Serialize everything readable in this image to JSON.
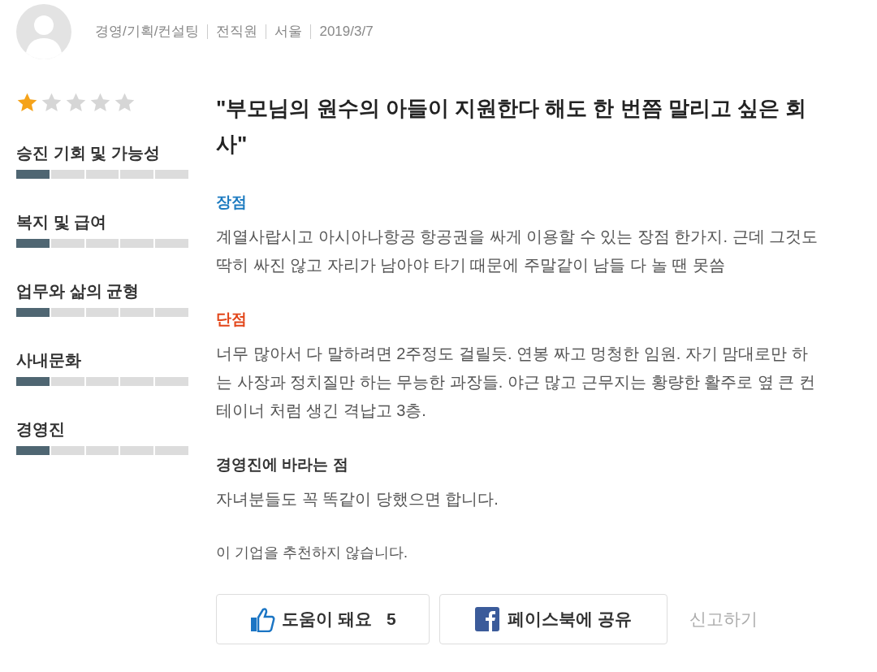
{
  "author": {
    "meta": [
      "경영/기획/컨설팅",
      "전직원",
      "서울",
      "2019/3/7"
    ]
  },
  "rating": {
    "stars": 1
  },
  "categories": [
    {
      "label": "승진 기회 및 가능성",
      "level": 0.2
    },
    {
      "label": "복지 및 급여",
      "level": 0.2
    },
    {
      "label": "업무와 삶의 균형",
      "level": 0.2
    },
    {
      "label": "사내문화",
      "level": 0.2
    },
    {
      "label": "경영진",
      "level": 0.2
    }
  ],
  "review": {
    "title": "\"부모님의 원수의 아들이 지원한다 해도 한 번쯤 말리고 싶은 회사\"",
    "sections": [
      {
        "kind": "pros",
        "heading": "장점",
        "body": "계열사랍시고 아시아나항공 항공권을 싸게 이용할 수 있는 장점 한가지. 근데 그것도 딱히 싸진 않고 자리가 남아야 타기 때문에 주말같이 남들 다 놀 땐 못씀"
      },
      {
        "kind": "cons",
        "heading": "단점",
        "body": "너무 많아서 다 말하려면 2주정도 걸릴듯. 연봉 짜고 멍청한 임원. 자기 맘대로만 하는 사장과 정치질만 하는 무능한 과장들. 야근 많고 근무지는 황량한 활주로 옆 큰 컨테이너 처럼 생긴 격납고 3층."
      },
      {
        "kind": "message",
        "heading": "경영진에 바라는 점",
        "body": "자녀분들도 꼭 똑같이 당했으면 합니다."
      }
    ],
    "recommendation": "이 기업을 추천하지 않습니다."
  },
  "actions": {
    "helpful": {
      "label": "도움이 돼요",
      "count": "5"
    },
    "share": {
      "label": "페이스북에 공유"
    },
    "report": "신고하기"
  }
}
